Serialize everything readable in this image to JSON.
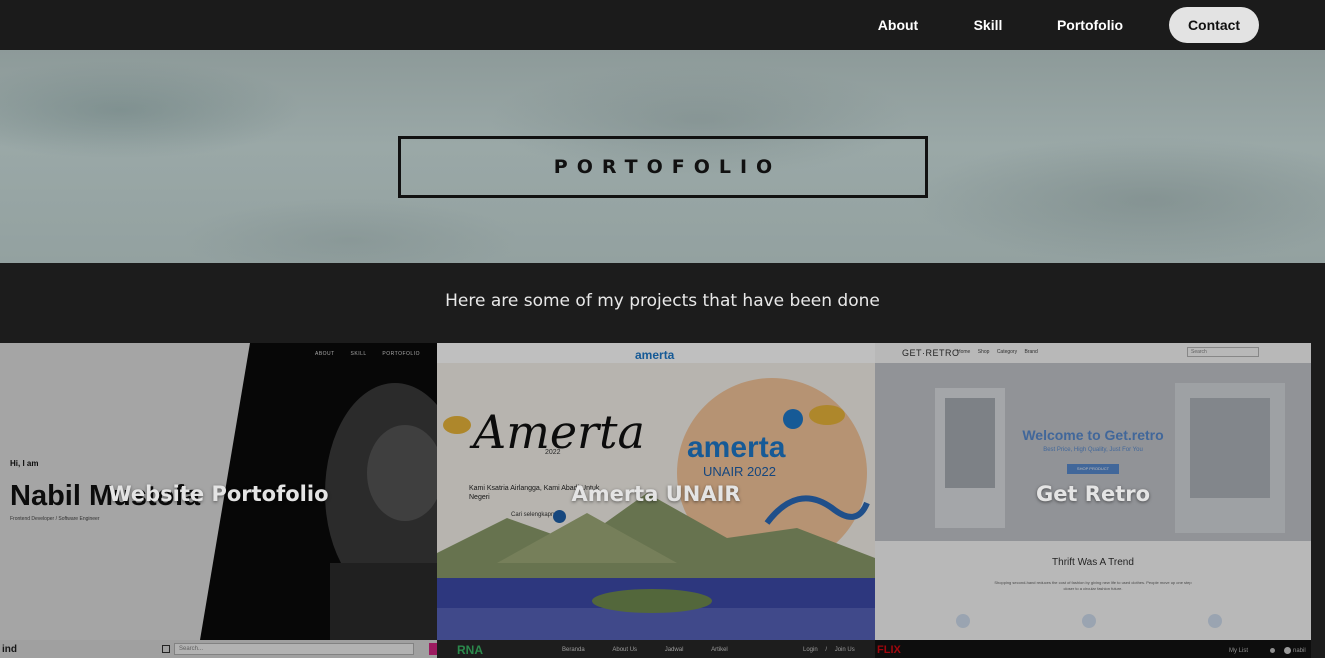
{
  "nav": {
    "links": [
      "About",
      "Skill",
      "Portofolio"
    ],
    "contact": "Contact"
  },
  "hero": {
    "title": "PORTOFOLIO"
  },
  "section": {
    "subtitle": "Here are some of my projects that have been done"
  },
  "projects": [
    {
      "title": "Website Portofolio",
      "preview": {
        "nav": [
          "ABOUT",
          "SKILL",
          "PORTOFOLIO"
        ],
        "greeting": "Hi, I am",
        "name": "Nabil Mustofa",
        "role": "Frontend Developer / Software Engineer"
      }
    },
    {
      "title": "Amerta UNAIR",
      "preview": {
        "logo": "amerta",
        "script_title": "Amerta",
        "year": "2022",
        "tagline": "Kami Ksatria Airlangga, Kami Abadi Untuk Negeri",
        "brand": "amerta",
        "brand_sub": "UNAIR 2022",
        "cta": "Cari selengkapnya"
      }
    },
    {
      "title": "Get Retro",
      "preview": {
        "logo": "GET·RETRO",
        "nav": [
          "Home",
          "Shop",
          "Category",
          "Brand"
        ],
        "search_placeholder": "Search",
        "headline": "Welcome to Get.retro",
        "sub": "Best Price, High Quality, Just For You",
        "button": "SHOP PRODUCT",
        "section_title": "Thrift Was A Trend",
        "section_text": "Shopping second-hand reduces the cost of fashion by giving new life to used clothes. People move up one step closer to a circular fashion future."
      }
    },
    {
      "title": "",
      "preview": {
        "label": "ind",
        "search_placeholder": "Search..."
      }
    },
    {
      "title": "",
      "preview": {
        "logo": "RNA",
        "nav": [
          "Beranda",
          "About Us",
          "Jadwal",
          "Artikel"
        ],
        "login": "Login",
        "join": "Join Us"
      }
    },
    {
      "title": "",
      "preview": {
        "logo": "FLIX",
        "list": "My List",
        "user": "nabil"
      }
    }
  ],
  "colors": {
    "page_bg": "#1c1c1c",
    "nav_bg": "#1b1b1b",
    "amerta_blue": "#1e78c8",
    "retro_blue": "#5b8fd6"
  }
}
